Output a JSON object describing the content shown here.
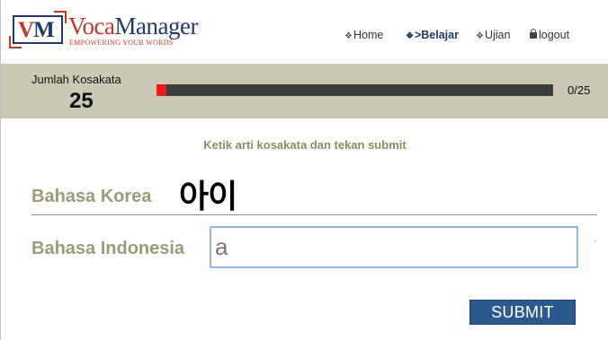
{
  "logo": {
    "mark_v": "V",
    "mark_m": "M",
    "name_part1": "Voca",
    "name_part2": "Manager",
    "tagline": "EMPOWERING YOUR WORDS"
  },
  "nav": {
    "items": [
      {
        "icon": "diamond-arrows-icon",
        "label": "Home",
        "active": false
      },
      {
        "icon": "diamond-arrows-icon",
        "label": ">Belajar",
        "active": true
      },
      {
        "icon": "diamond-arrows-icon",
        "label": "Ujian",
        "active": false
      },
      {
        "icon": "lock-icon",
        "label": "logout",
        "active": false
      }
    ]
  },
  "progress": {
    "label": "Jumlah Kosakata",
    "count": "25",
    "current": 0,
    "total": 25,
    "display": "0/25",
    "fill_fraction": 0.025,
    "fill_color": "#ee1b1b",
    "track_color": "#3d3d3d",
    "band_color": "#cbc8b4"
  },
  "quiz": {
    "instruction": "Ketik arti kosakata dan tekan submit",
    "korean_label": "Bahasa Korea",
    "korean_word": "아이",
    "indonesian_label": "Bahasa Indonesia",
    "answer_value": "a",
    "submit_label": "SUBMIT"
  },
  "colors": {
    "brand_red": "#c0392b",
    "brand_navy": "#1f3b66",
    "label_olive": "#9e9a78",
    "submit_blue": "#2d5a8c",
    "input_border": "#8eb6e8"
  }
}
